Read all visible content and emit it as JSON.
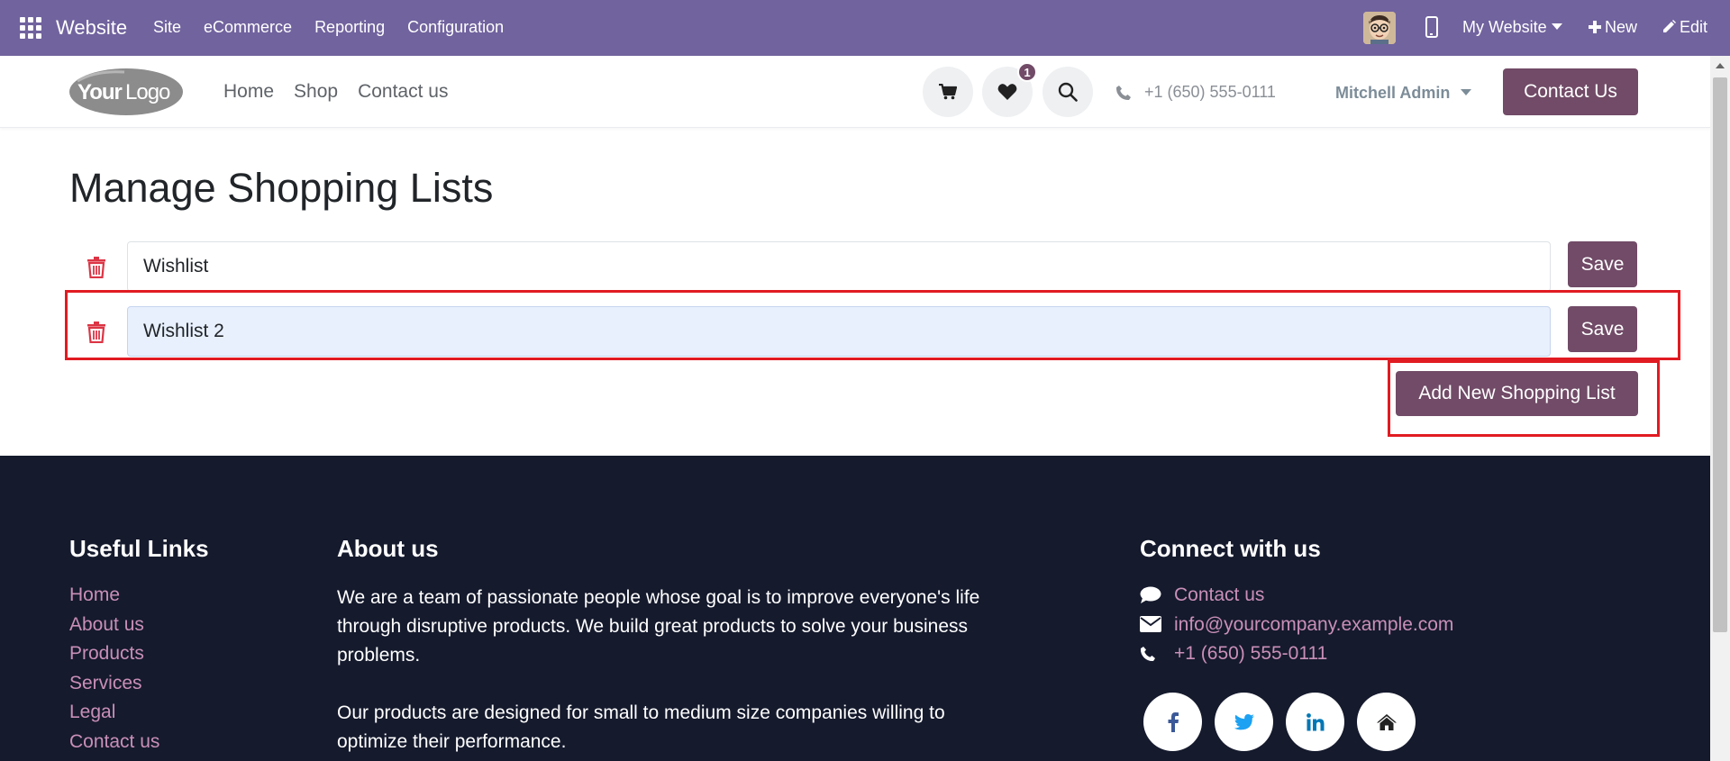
{
  "admin_bar": {
    "brand": "Website",
    "menu": [
      "Site",
      "eCommerce",
      "Reporting",
      "Configuration"
    ],
    "my_website": "My Website",
    "new_label": "New",
    "edit_label": "Edit",
    "icons": [
      "apps-grid-icon",
      "user-avatar",
      "mobile-icon",
      "plus-icon",
      "pencil-icon"
    ],
    "color": "#71639e"
  },
  "site_header": {
    "nav": [
      "Home",
      "Shop",
      "Contact us"
    ],
    "wishlist_count": "1",
    "phone": "+1 (650) 555-0111",
    "user": "Mitchell Admin",
    "contact_button": "Contact Us",
    "icons": [
      "cart-icon",
      "heart-icon",
      "search-icon",
      "phone-icon"
    ],
    "accent": "#714b67"
  },
  "main": {
    "title": "Manage Shopping Lists",
    "lists": [
      {
        "name": "Wishlist",
        "save_label": "Save"
      },
      {
        "name": "Wishlist 2",
        "save_label": "Save"
      }
    ],
    "add_button": "Add New Shopping List",
    "highlight_color": "#e11b22"
  },
  "footer": {
    "useful_links_title": "Useful Links",
    "useful_links": [
      "Home",
      "About us",
      "Products",
      "Services",
      "Legal",
      "Contact us"
    ],
    "about_title": "About us",
    "about_paragraphs": [
      "We are a team of passionate people whose goal is to improve everyone's life through disruptive products. We build great products to solve your business problems.",
      "Our products are designed for small to medium size companies willing to optimize their performance."
    ],
    "connect_title": "Connect with us",
    "connect": {
      "contact": "Contact us",
      "email": "info@yourcompany.example.com",
      "phone": "+1 (650) 555-0111"
    },
    "social_icons": [
      "facebook-icon",
      "twitter-icon",
      "linkedin-icon",
      "home-icon"
    ],
    "background": "#151a2d",
    "link_color": "#c98fb8"
  }
}
